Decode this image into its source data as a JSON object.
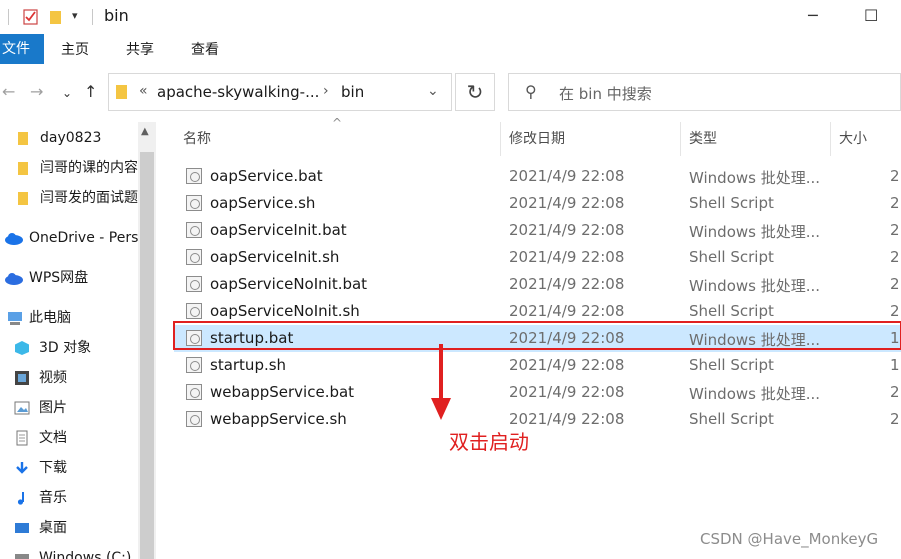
{
  "window": {
    "title": "bin"
  },
  "ribbon": {
    "file": "文件",
    "tabs": [
      "主页",
      "共享",
      "查看"
    ]
  },
  "address": {
    "segments": [
      "apache-skywalking-...",
      "bin"
    ]
  },
  "search": {
    "placeholder": "在 bin 中搜索"
  },
  "nav": {
    "items": [
      {
        "label": "day0823",
        "icon": "folder-icon"
      },
      {
        "label": "闫哥的课的内容",
        "icon": "folder-icon"
      },
      {
        "label": "闫哥发的面试题",
        "icon": "folder-icon"
      },
      {
        "label": "OneDrive - Personal",
        "icon": "cloud-icon"
      },
      {
        "label": "WPS网盘",
        "icon": "cloud-icon"
      },
      {
        "label": "此电脑",
        "icon": "computer-icon"
      },
      {
        "label": "3D 对象",
        "icon": "cube-icon"
      },
      {
        "label": "视频",
        "icon": "video-icon"
      },
      {
        "label": "图片",
        "icon": "picture-icon"
      },
      {
        "label": "文档",
        "icon": "document-icon"
      },
      {
        "label": "下载",
        "icon": "download-icon"
      },
      {
        "label": "音乐",
        "icon": "music-icon"
      },
      {
        "label": "桌面",
        "icon": "desktop-icon"
      },
      {
        "label": "Windows (C:)",
        "icon": "drive-icon"
      }
    ]
  },
  "columns": {
    "name": "名称",
    "date": "修改日期",
    "type": "类型",
    "size": "大小"
  },
  "files": [
    {
      "name": "oapService.bat",
      "date": "2021/4/9 22:08",
      "type": "Windows 批处理...",
      "size": "2"
    },
    {
      "name": "oapService.sh",
      "date": "2021/4/9 22:08",
      "type": "Shell Script",
      "size": "2"
    },
    {
      "name": "oapServiceInit.bat",
      "date": "2021/4/9 22:08",
      "type": "Windows 批处理...",
      "size": "2"
    },
    {
      "name": "oapServiceInit.sh",
      "date": "2021/4/9 22:08",
      "type": "Shell Script",
      "size": "2"
    },
    {
      "name": "oapServiceNoInit.bat",
      "date": "2021/4/9 22:08",
      "type": "Windows 批处理...",
      "size": "2"
    },
    {
      "name": "oapServiceNoInit.sh",
      "date": "2021/4/9 22:08",
      "type": "Shell Script",
      "size": "2"
    },
    {
      "name": "startup.bat",
      "date": "2021/4/9 22:08",
      "type": "Windows 批处理...",
      "size": "1"
    },
    {
      "name": "startup.sh",
      "date": "2021/4/9 22:08",
      "type": "Shell Script",
      "size": "1"
    },
    {
      "name": "webappService.bat",
      "date": "2021/4/9 22:08",
      "type": "Windows 批处理...",
      "size": "2"
    },
    {
      "name": "webappService.sh",
      "date": "2021/4/9 22:08",
      "type": "Shell Script",
      "size": "2"
    }
  ],
  "selected_file": "startup.bat",
  "annotation": {
    "text": "双击启动",
    "color": "#e02020"
  },
  "watermark": "CSDN @Have_MonkeyG"
}
